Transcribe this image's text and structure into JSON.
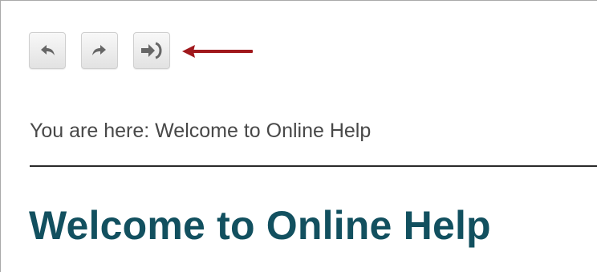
{
  "toolbar": {
    "buttons": [
      {
        "name": "back",
        "icon": "arrow-left-icon"
      },
      {
        "name": "forward",
        "icon": "arrow-right-icon"
      },
      {
        "name": "remove-highlight",
        "icon": "arrow-into-sign-icon"
      }
    ],
    "icon_color": "#666666",
    "callout_arrow_color": "#a0181c"
  },
  "breadcrumb": {
    "prefix": "You are here:",
    "current": "Welcome to Online Help"
  },
  "page": {
    "title": "Welcome to Online Help",
    "title_color": "#12505f"
  }
}
